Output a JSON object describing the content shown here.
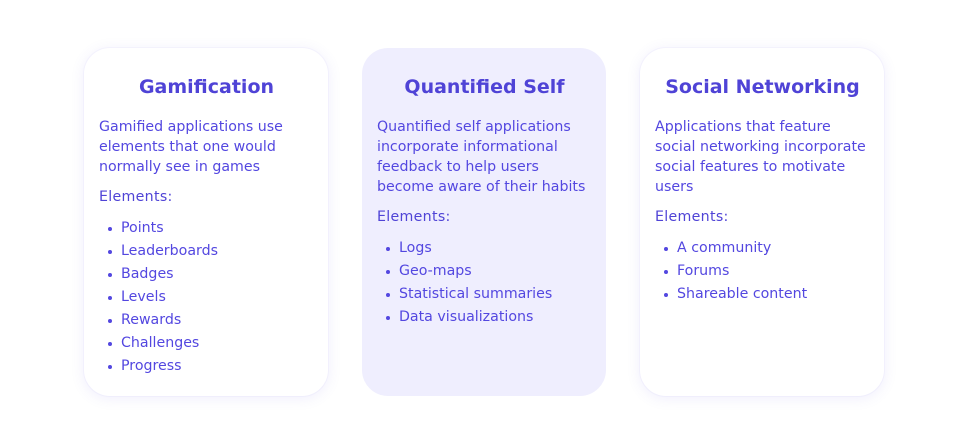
{
  "cards": [
    {
      "title": "Gamification",
      "description": "Gamified applications use elements that one would normally see in games",
      "elements_label": "Elements:",
      "items": [
        "Points",
        "Leaderboards",
        "Badges",
        "Levels",
        "Rewards",
        "Challenges",
        "Progress"
      ]
    },
    {
      "title": "Quantified Self",
      "description": "Quantified self applications incorporate informational feedback to help users become aware of their habits",
      "elements_label": "Elements:",
      "items": [
        "Logs",
        "Geo-maps",
        "Statistical summaries",
        "Data visualizations"
      ]
    },
    {
      "title": "Social Networking",
      "description": "Applications that feature social networking incorporate social features to motivate users",
      "elements_label": "Elements:",
      "items": [
        "A community",
        "Forums",
        "Shareable content"
      ]
    }
  ],
  "colors": {
    "accent": "#4f43d6",
    "highlight_background": "#efeefe",
    "card_background": "#ffffff"
  }
}
